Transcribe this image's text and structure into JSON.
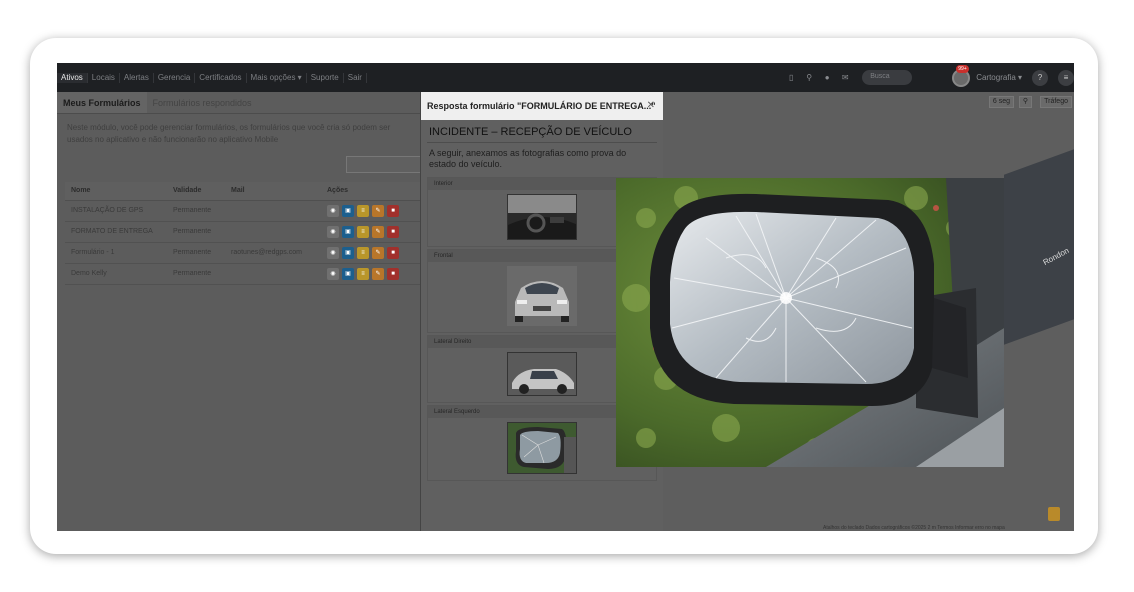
{
  "nav": {
    "items": [
      "Ativos",
      "Locais",
      "Alertas",
      "Gerencia",
      "Certificados",
      "Mais opções ▾",
      "Suporte",
      "Sair"
    ],
    "search_placeholder": "Busca",
    "badge": "99+",
    "cartography": "Cartografia ▾"
  },
  "tabs": {
    "my_forms": "Meus Formulários",
    "answered": "Formulários respondidos"
  },
  "description": "Neste módulo, você pode gerenciar formulários, os formulários que você cria só podem ser usados no aplicativo e não funcionarão no aplicativo Mobile",
  "table": {
    "headers": [
      "Nome",
      "Validade",
      "Mail",
      "Ações"
    ],
    "rows": [
      [
        "INSTALAÇÃO DE GPS",
        "Permanente",
        ""
      ],
      [
        "FORMATO DE ENTREGA",
        "Permanente",
        ""
      ],
      [
        "Formulário - 1",
        "Permanente",
        "raotunes@redgps.com"
      ],
      [
        "Demo Kelly",
        "Permanente",
        ""
      ]
    ]
  },
  "modal": {
    "title": "Resposta formulário \"FORMULÁRIO DE ENTREGA...\"",
    "close": "✕",
    "incident_title": "INCIDENTE – RECEPÇÃO DE VEÍCULO",
    "incident_desc": "A seguir, anexamos as fotografias como prova do estado do veículo.",
    "sections": [
      "Interior",
      "Frontal",
      "Lateral Direito",
      "Lateral Esquerdo"
    ]
  },
  "map": {
    "refresh": "6 seg",
    "traffic": "Tráfego",
    "street": "Rondon",
    "footer": "Atalhos do teclado   Dados cartográficos ©2025   2 m   Termos   Informar erro no mapa"
  },
  "colors": {
    "nav_bg": "#1e2023",
    "dim_bg": "#5a5a5a",
    "badge_red": "#c9302c"
  }
}
